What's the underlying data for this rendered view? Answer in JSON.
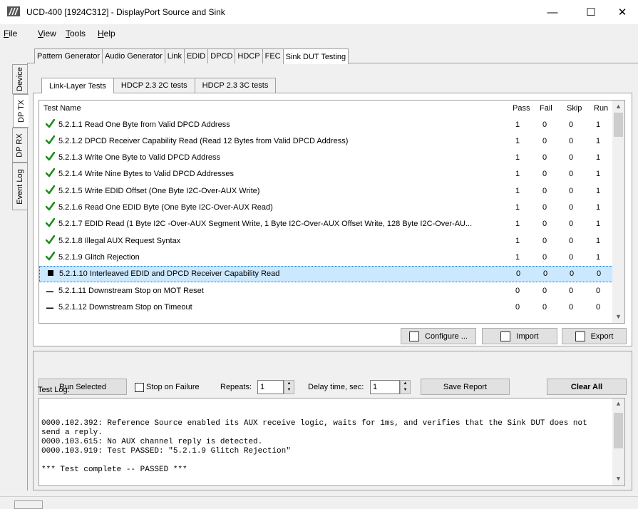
{
  "window": {
    "title": "UCD-400 [1924C312] - DisplayPort Source and Sink",
    "minimize": "—",
    "maximize": "☐",
    "close": "✕"
  },
  "menu": [
    {
      "label": "File"
    },
    {
      "label": "View"
    },
    {
      "label": "Tools"
    },
    {
      "label": "Help"
    }
  ],
  "side_tabs": [
    "Device",
    "DP TX",
    "DP RX",
    "Event Log"
  ],
  "top_tabs": [
    "Pattern Generator",
    "Audio Generator",
    "Link",
    "EDID",
    "DPCD",
    "HDCP",
    "FEC",
    "Sink DUT Testing"
  ],
  "sub_tabs": [
    "Link-Layer Tests",
    "HDCP 2.3 2C tests",
    "HDCP 2.3 3C tests"
  ],
  "table": {
    "headers": {
      "name": "Test Name",
      "pass": "Pass",
      "fail": "Fail",
      "skip": "Skip",
      "run": "Run"
    },
    "rows": [
      {
        "status": "pass",
        "name": "5.2.1.1 Read One Byte from Valid DPCD Address",
        "pass": "1",
        "fail": "0",
        "skip": "0",
        "run": "1"
      },
      {
        "status": "pass",
        "name": "5.2.1.2 DPCD Receiver Capability Read (Read 12 Bytes from Valid DPCD Address)",
        "pass": "1",
        "fail": "0",
        "skip": "0",
        "run": "1"
      },
      {
        "status": "pass",
        "name": "5.2.1.3 Write One Byte to Valid DPCD Address",
        "pass": "1",
        "fail": "0",
        "skip": "0",
        "run": "1"
      },
      {
        "status": "pass",
        "name": "5.2.1.4 Write Nine Bytes to Valid DPCD Addresses",
        "pass": "1",
        "fail": "0",
        "skip": "0",
        "run": "1"
      },
      {
        "status": "pass",
        "name": "5.2.1.5 Write EDID Offset (One Byte I2C-Over-AUX Write)",
        "pass": "1",
        "fail": "0",
        "skip": "0",
        "run": "1"
      },
      {
        "status": "pass",
        "name": "5.2.1.6 Read One EDID Byte (One Byte I2C-Over-AUX Read)",
        "pass": "1",
        "fail": "0",
        "skip": "0",
        "run": "1"
      },
      {
        "status": "pass",
        "name": "5.2.1.7 EDID Read (1 Byte I2C -Over-AUX Segment Write, 1 Byte I2C-Over-AUX Offset Write, 128 Byte I2C-Over-AU...",
        "pass": "1",
        "fail": "0",
        "skip": "0",
        "run": "1"
      },
      {
        "status": "pass",
        "name": "5.2.1.8 Illegal AUX Request Syntax",
        "pass": "1",
        "fail": "0",
        "skip": "0",
        "run": "1"
      },
      {
        "status": "pass",
        "name": "5.2.1.9 Glitch Rejection",
        "pass": "1",
        "fail": "0",
        "skip": "0",
        "run": "1"
      },
      {
        "status": "selected",
        "name": "5.2.1.10 Interleaved EDID and DPCD Receiver Capability Read",
        "pass": "0",
        "fail": "0",
        "skip": "0",
        "run": "0"
      },
      {
        "status": "none",
        "name": "5.2.1.11 Downstream Stop on MOT Reset",
        "pass": "0",
        "fail": "0",
        "skip": "0",
        "run": "0"
      },
      {
        "status": "none",
        "name": "5.2.1.12 Downstream Stop on Timeout",
        "pass": "0",
        "fail": "0",
        "skip": "0",
        "run": "0"
      }
    ]
  },
  "buttons": {
    "configure": "Configure ...",
    "import": "Import",
    "export": "Export",
    "run_selected": "Run Selected",
    "save_report": "Save Report",
    "clear_all": "Clear All"
  },
  "options": {
    "stop_on_failure": "Stop on Failure",
    "repeats_label": "Repeats:",
    "repeats_value": "1",
    "delay_label": "Delay time, sec:",
    "delay_value": "1"
  },
  "log": {
    "label": "Test Log:",
    "text": "0000.102.392: Reference Source enabled its AUX receive logic, waits for 1ms, and verifies that the Sink DUT does not send a reply.\n0000.103.615: No AUX channel reply is detected.\n0000.103.919: Test PASSED: \"5.2.1.9 Glitch Rejection\"\n\n*** Test complete -- PASSED ***"
  },
  "icons": {
    "pass": "check-icon",
    "selected": "running-square-icon",
    "none": "dash-icon"
  },
  "colors": {
    "check": "#1e8c1e",
    "selection": "#cce8ff"
  }
}
